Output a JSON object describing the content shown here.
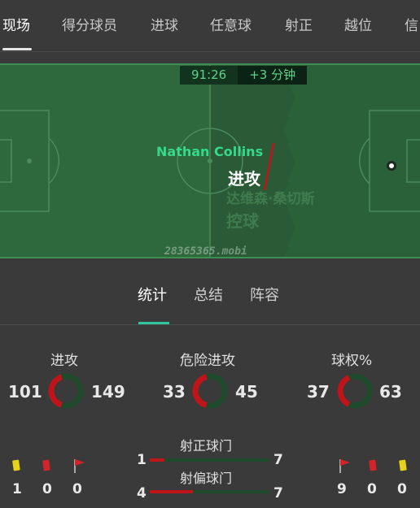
{
  "tabs": [
    {
      "label": "现场"
    },
    {
      "label": "得分球员"
    },
    {
      "label": "进球"
    },
    {
      "label": "任意球"
    },
    {
      "label": "射正"
    },
    {
      "label": "越位"
    },
    {
      "label": "信"
    }
  ],
  "pitch": {
    "clock_time": "91:26",
    "added_time": "+3 分钟",
    "player_name": "Nathan Collins",
    "event": "进攻",
    "ghost_line1": "达维森·桑切斯",
    "ghost_line2": "控球",
    "watermark": "28365365.mobi"
  },
  "subtabs": [
    {
      "label": "统计"
    },
    {
      "label": "总结"
    },
    {
      "label": "阵容"
    }
  ],
  "stats": [
    {
      "title": "进攻",
      "home": "101",
      "away": "149",
      "home_value": 101,
      "away_value": 149
    },
    {
      "title": "危险进攻",
      "home": "33",
      "away": "45",
      "home_value": 33,
      "away_value": 45
    },
    {
      "title": "球权%",
      "home": "37",
      "away": "63",
      "home_value": 37,
      "away_value": 63
    }
  ],
  "bars": [
    {
      "label": "射正球门",
      "home": "1",
      "away": "7",
      "home_value": 1,
      "away_value": 7
    },
    {
      "label": "射偏球门",
      "home": "4",
      "away": "7",
      "home_value": 4,
      "away_value": 7
    }
  ],
  "home_cards": {
    "yellow": "1",
    "red": "0",
    "corners": "0"
  },
  "away_cards": {
    "corners": "9",
    "red": "0",
    "yellow": "0"
  },
  "colors": {
    "home": "#c0141b",
    "away": "#1f4a2c",
    "accent": "#2fc6a0",
    "pitch": "#2f6a3f"
  },
  "icons": {
    "yellow_card": "yellow-card-icon",
    "red_card": "red-card-icon",
    "corner": "corner-flag-icon"
  }
}
